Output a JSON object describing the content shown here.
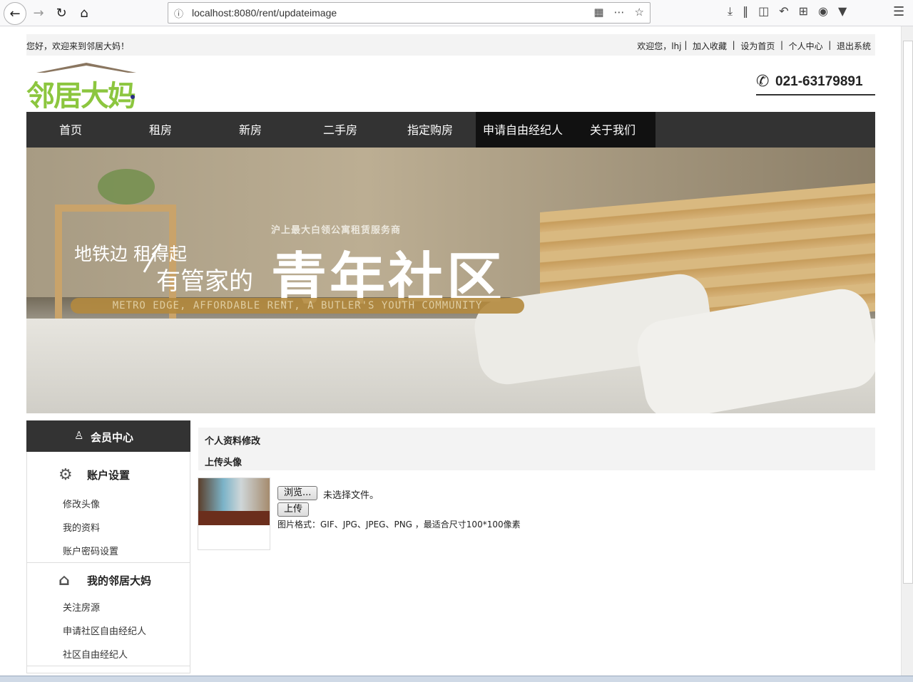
{
  "browser": {
    "url": "localhost:8080/rent/updateimage"
  },
  "topbar": {
    "welcome": "您好，欢迎来到邻居大妈！",
    "user_greeting": "欢迎您，lhj",
    "links": [
      "加入收藏",
      "设为首页",
      "个人中心",
      "退出系统"
    ]
  },
  "header": {
    "logo_text": "邻居大妈",
    "phone": "021-63179891"
  },
  "nav": {
    "items": [
      "首页",
      "租房",
      "新房",
      "二手房",
      "指定购房",
      "申请自由经纪人",
      "关于我们"
    ],
    "active_index": 5
  },
  "banner": {
    "small_text": "沪上最大白领公寓租赁服务商",
    "line1": "地铁边  租得起",
    "line2": "有管家的",
    "big_text": "青年社区",
    "english": "METRO EDGE, AFFORDABLE RENT, A BUTLER'S YOUTH COMMUNITY"
  },
  "sidebar": {
    "header": "会员中心",
    "sections": [
      {
        "title": "账户设置",
        "icon": "gear-icon",
        "links": [
          "修改头像",
          "我的资料",
          "账户密码设置"
        ]
      },
      {
        "title": "我的邻居大妈",
        "icon": "house-icon",
        "links": [
          "关注房源",
          "申请社区自由经纪人",
          "社区自由经纪人"
        ]
      }
    ]
  },
  "content": {
    "title": "个人资料修改",
    "subtitle": "上传头像",
    "browse_label": "浏览...",
    "file_status": "未选择文件。",
    "upload_label": "上传",
    "format_note": "图片格式：GIF、JPG、JPEG、PNG ，最适合尺寸100*100像素"
  }
}
